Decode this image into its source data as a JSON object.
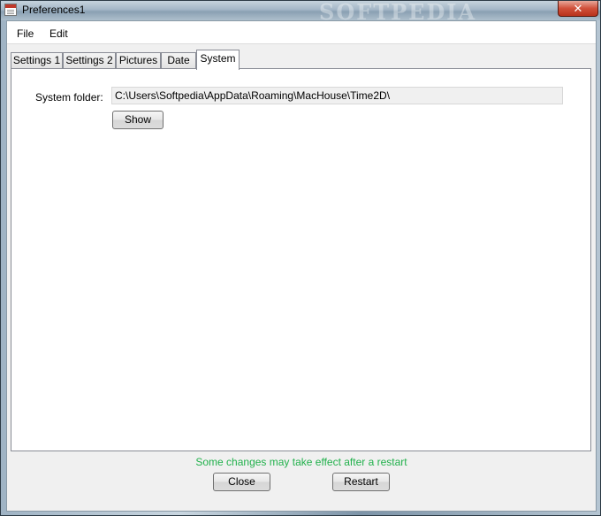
{
  "window": {
    "title": "Preferences1",
    "close_glyph": "✕",
    "watermark": "SOFTPEDIA"
  },
  "menu": {
    "items": [
      {
        "label": "File"
      },
      {
        "label": "Edit"
      }
    ]
  },
  "tabs": [
    {
      "label": "Settings 1",
      "active": false
    },
    {
      "label": "Settings 2",
      "active": false
    },
    {
      "label": "Pictures",
      "active": false
    },
    {
      "label": "Date",
      "active": false
    },
    {
      "label": "System",
      "active": true
    }
  ],
  "system": {
    "folder_label": "System folder:",
    "folder_value": "C:\\Users\\Softpedia\\AppData\\Roaming\\MacHouse\\Time2D\\",
    "show_label": "Show"
  },
  "footer": {
    "status_text": "Some changes may take effect after a restart",
    "status_color": "#22b14c",
    "close_label": "Close",
    "restart_label": "Restart"
  },
  "icons": {
    "app": "app-icon",
    "close": "close-icon"
  }
}
